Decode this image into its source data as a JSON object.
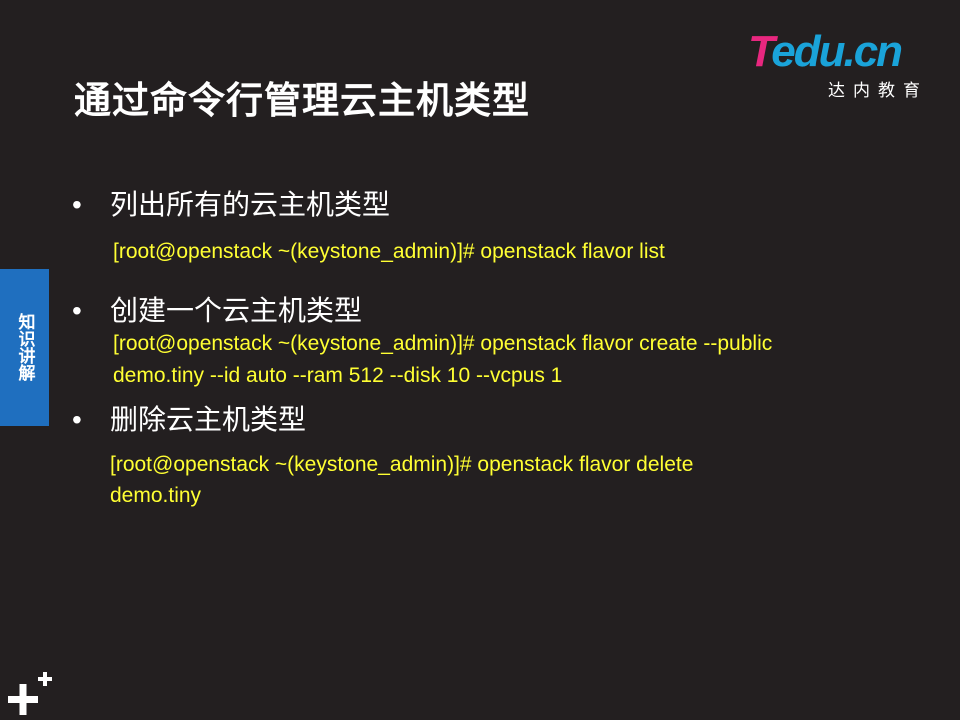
{
  "slide": {
    "title": "通过命令行管理云主机类型",
    "logo": {
      "brand_t": "T",
      "brand_rest": "edu.cn",
      "subtitle": "达内教育"
    },
    "side_tab": "知识讲解",
    "items": [
      {
        "bullet": "•",
        "heading": "列出所有的云主机类型",
        "commands": [
          "[root@openstack ~(keystone_admin)]# openstack flavor list"
        ]
      },
      {
        "bullet": "•",
        "heading": "创建一个云主机类型",
        "commands": [
          "[root@openstack ~(keystone_admin)]# openstack flavor create --public",
          "demo.tiny --id auto --ram 512 --disk 10 --vcpus 1"
        ]
      },
      {
        "bullet": "•",
        "heading": "删除云主机类型",
        "commands": [
          "[root@openstack ~(keystone_admin)]# openstack flavor delete",
          "demo.tiny"
        ]
      }
    ]
  },
  "colors": {
    "background": "#231f20",
    "command_text": "#ffff33",
    "side_tab": "#1f6fbf",
    "logo_pink": "#e8277f",
    "logo_blue": "#1aa3d9"
  },
  "icons": {
    "corner": "plus-icon"
  }
}
